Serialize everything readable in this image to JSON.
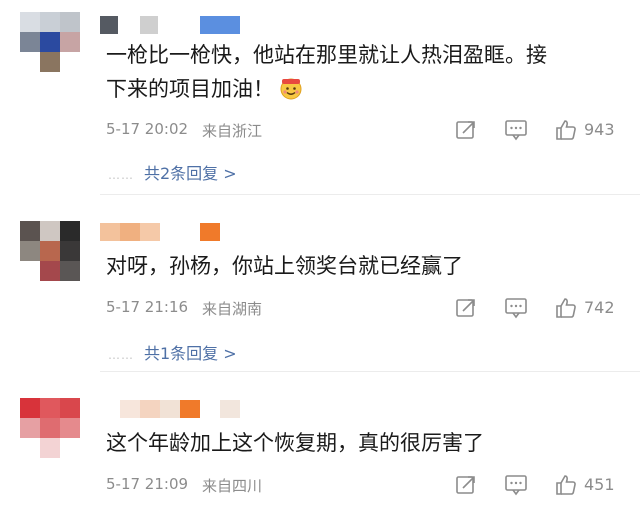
{
  "comments": [
    {
      "text_line1": "一枪比一枪快，他站在那里就让人热泪盈眶。接",
      "text_line2": "下来的项目加油！",
      "time": "5-17 20:02",
      "location": "来自浙江",
      "likes": "943",
      "replies": "共2条回复 >"
    },
    {
      "text_line1": "对呀，孙杨，你站上领奖台就已经赢了",
      "time": "5-17 21:16",
      "location": "来自湖南",
      "likes": "742",
      "replies": "共1条回复 >"
    },
    {
      "text_line1": "这个年龄加上这个恢复期，真的很厉害了",
      "time": "5-17 21:09",
      "location": "来自四川",
      "likes": "451"
    }
  ],
  "icons": {
    "repost": "repost-icon",
    "comment": "comment-icon",
    "like": "like-icon",
    "emoji": "cheer-emoji"
  },
  "colors": {
    "link": "#4e70a6",
    "meta": "#8c8c8c",
    "text": "#1a1a1a"
  },
  "replies_dots": "……"
}
